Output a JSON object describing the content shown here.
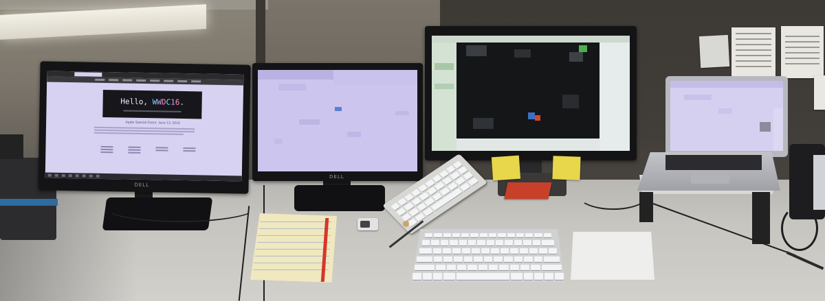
{
  "photo": {
    "monitor_left": {
      "hero_text": "Hello, WWDC16.",
      "subtitle": "Apple Special Event. June 13, 2016",
      "brand": "DELL"
    },
    "monitor_center": {
      "brand": "DELL"
    }
  },
  "colors": {
    "screen_glow": "#d7d2f1",
    "sticky_note": "#e8d64b",
    "notepad": "#f0e8bf",
    "margin_line": "#d8352c",
    "red_pad": "#c8402a",
    "desk": "#c7c5c0"
  }
}
